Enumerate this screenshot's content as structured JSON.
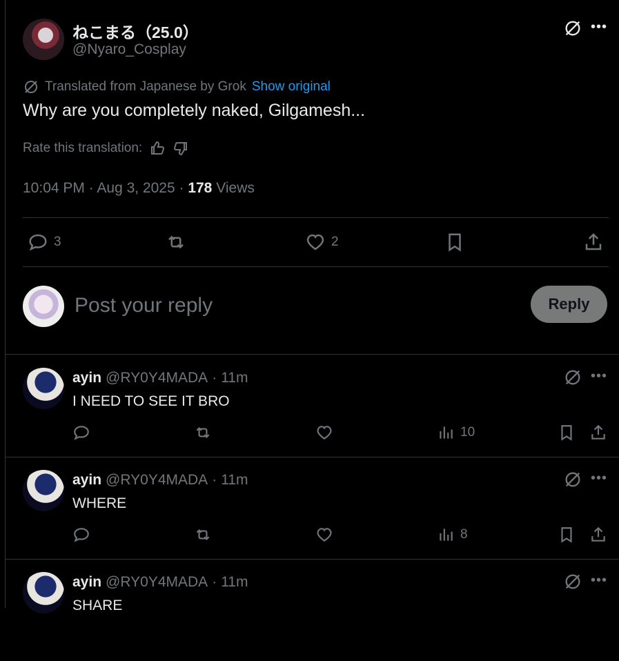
{
  "post": {
    "author_name": "ねこまる（25.0）",
    "author_handle": "@Nyaro_Cosplay",
    "translated_label": "Translated from Japanese by Grok",
    "show_original": "Show original",
    "text": "Why are you completely naked, Gilgamesh...",
    "rate_label": "Rate this translation:",
    "time_date": "10:04 PM · Aug 3, 2025 · ",
    "views_count": "178",
    "views_label": "Views",
    "reply_count": "3",
    "like_count": "2"
  },
  "reply_box": {
    "placeholder": "Post your reply",
    "button_label": "Reply"
  },
  "comments": [
    {
      "name": "ayin",
      "handle": "@RY0Y4MADA",
      "sep": "·",
      "time": "11m",
      "text": "I NEED TO SEE IT BRO",
      "views": "10"
    },
    {
      "name": "ayin",
      "handle": "@RY0Y4MADA",
      "sep": "·",
      "time": "11m",
      "text": "WHERE",
      "views": "8"
    },
    {
      "name": "ayin",
      "handle": "@RY0Y4MADA",
      "sep": "·",
      "time": "11m",
      "text": "SHARE",
      "views": ""
    }
  ],
  "icons": {
    "more": "more-icon",
    "grok": "grok-icon",
    "reply": "reply-icon",
    "repost": "repost-icon",
    "like": "heart-icon",
    "bookmark": "bookmark-icon",
    "share": "share-icon",
    "views": "views-icon",
    "thumbs_up": "thumbs-up-icon",
    "thumbs_down": "thumbs-down-icon"
  },
  "colors": {
    "background": "#000000",
    "text": "#e7e9ea",
    "secondary": "#71767b",
    "link": "#1d9bf0",
    "divider": "#2f3336",
    "reply_button": "#787a7a"
  }
}
